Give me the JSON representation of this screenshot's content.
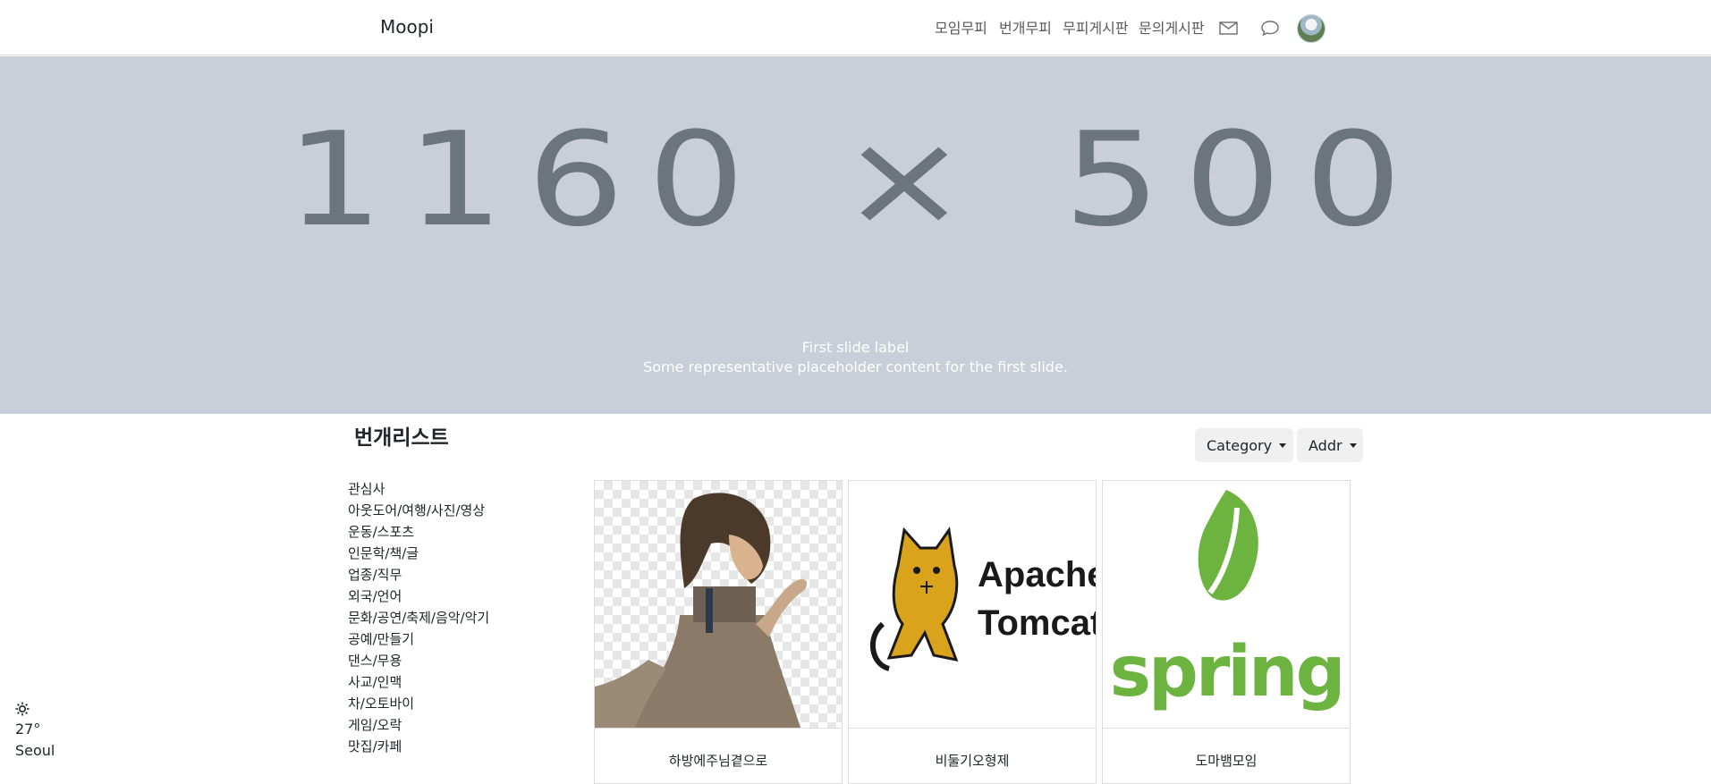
{
  "navbar": {
    "brand": "Moopi",
    "links": [
      "모임무피",
      "번개무피",
      "무피게시판",
      "문의게시판"
    ],
    "icons": [
      "envelope-icon",
      "chat-bubble-icon"
    ]
  },
  "hero": {
    "placeholder": "1160 × 500",
    "caption_title": "First slide label",
    "caption_text": "Some representative placeholder content for the first slide."
  },
  "section": {
    "title": "번개리스트",
    "category_button": "Category",
    "addr_button": "Addr"
  },
  "categories": [
    "관심사",
    "아웃도어/여행/사진/영상",
    "운동/스포츠",
    "인문학/책/글",
    "업종/직무",
    "외국/언어",
    "문화/공연/축제/음악/악기",
    "공예/만들기",
    "댄스/무용",
    "사교/인맥",
    "차/오토바이",
    "게임/오락",
    "맛집/카페"
  ],
  "cards": [
    {
      "title": "하방에주님곁으로",
      "image": "anime-character-image"
    },
    {
      "title": "비둘기오형제",
      "image": "apache-tomcat-logo"
    },
    {
      "title": "도마뱀모임",
      "image": "spring-logo"
    }
  ],
  "tomcat_logo_text": [
    "Apache",
    "Tomcat"
  ],
  "spring_logo_text": "spring",
  "weather": {
    "icon": "sun-icon",
    "temperature": "27°",
    "city": "Seoul"
  },
  "colors": {
    "hero_bg": "#c8cfd8",
    "placeholder_text": "#6c757d",
    "spring_green": "#6db33f",
    "tomcat_gold": "#d9a31c"
  }
}
